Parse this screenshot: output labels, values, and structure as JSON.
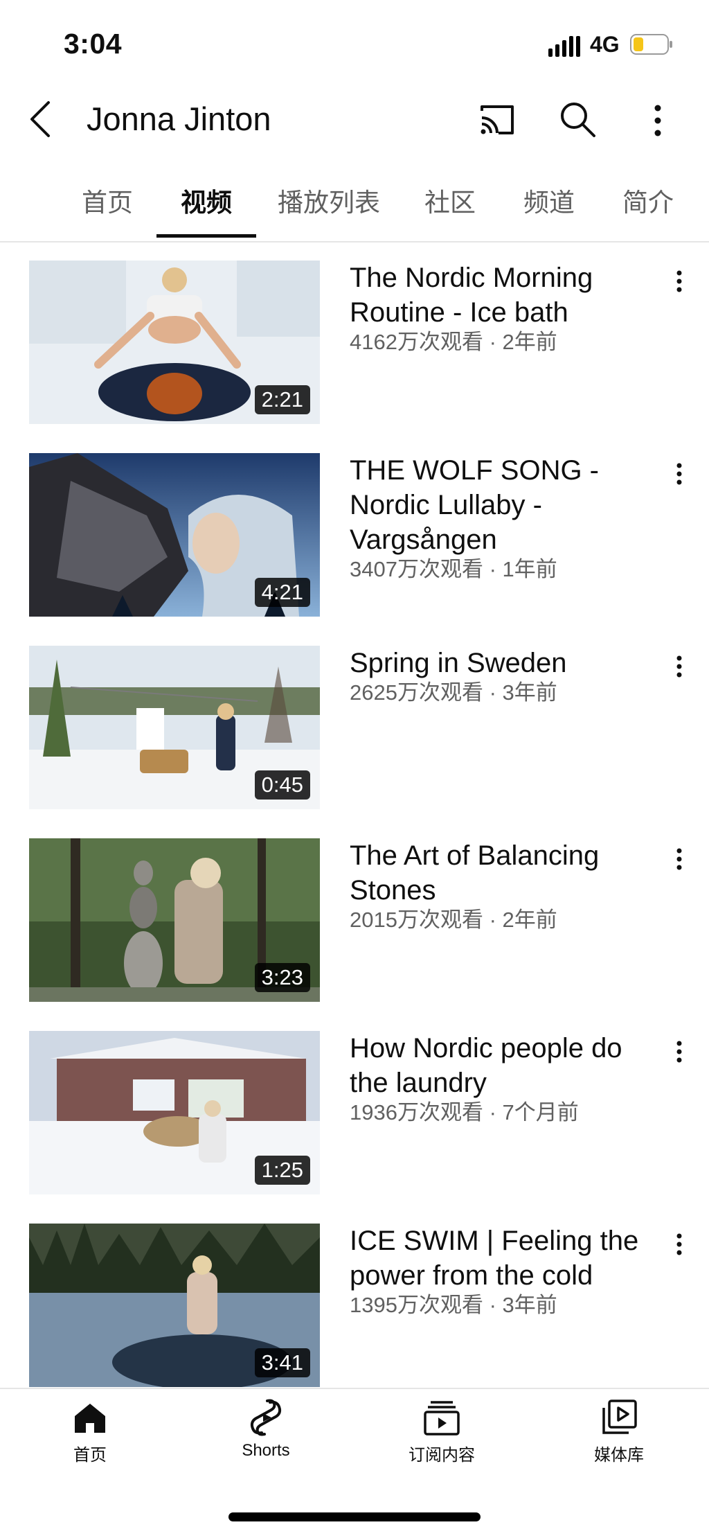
{
  "status_bar": {
    "time": "3:04",
    "network": "4G"
  },
  "header": {
    "title": "Jonna Jinton"
  },
  "tabs": [
    "首页",
    "视频",
    "播放列表",
    "社区",
    "频道",
    "简介"
  ],
  "active_tab": "视频",
  "videos": [
    {
      "title": "The Nordic Morning Routine - Ice bath",
      "meta": "4162万次观看 · 2年前",
      "duration": "2:21"
    },
    {
      "title": "THE WOLF SONG - Nordic Lullaby - Vargsången",
      "meta": "3407万次观看 · 1年前",
      "duration": "4:21"
    },
    {
      "title": "Spring in Sweden",
      "meta": "2625万次观看 · 3年前",
      "duration": "0:45"
    },
    {
      "title": "The Art of Balancing Stones",
      "meta": "2015万次观看 · 2年前",
      "duration": "3:23"
    },
    {
      "title": "How Nordic people do the laundry",
      "meta": "1936万次观看 · 7个月前",
      "duration": "1:25"
    },
    {
      "title": "ICE SWIM | Feeling the power from the cold",
      "meta": "1395万次观看 · 3年前",
      "duration": "3:41"
    }
  ],
  "bottom_nav": [
    {
      "label": "首页",
      "icon": "home-icon"
    },
    {
      "label": "Shorts",
      "icon": "shorts-icon"
    },
    {
      "label": "订阅内容",
      "icon": "subscriptions-icon"
    },
    {
      "label": "媒体库",
      "icon": "library-icon"
    }
  ],
  "colors": {
    "text": "#0f0f0f",
    "secondary": "#606060",
    "battery_fill": "#f5c518"
  }
}
